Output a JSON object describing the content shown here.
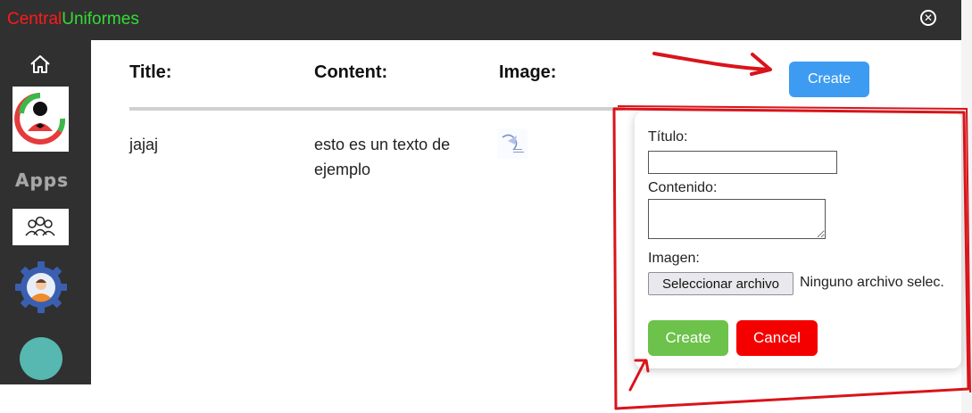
{
  "app": {
    "brand_part1": "Central",
    "brand_part2": "Uniformes",
    "close_icon": "close-circle-icon"
  },
  "sidebar": {
    "items": [
      {
        "icon": "home-icon"
      },
      {
        "icon": "logo-icon"
      },
      {
        "label": "Apps"
      },
      {
        "icon": "users-icon"
      },
      {
        "icon": "profile-settings-icon"
      },
      {
        "icon": "circle-icon"
      }
    ]
  },
  "table": {
    "headers": [
      "Title:",
      "Content:",
      "Image:"
    ],
    "rows": [
      {
        "title": "jajaj",
        "content": "esto es un texto de ejemplo",
        "image_icon": "thumbnail-image"
      }
    ]
  },
  "toolbar": {
    "create_label": "Create"
  },
  "modal": {
    "title_label": "Título:",
    "title_value": "",
    "content_label": "Contenido:",
    "content_value": "",
    "image_label": "Imagen:",
    "file_button_label": "Seleccionar archivo",
    "file_status": "Ninguno archivo selec.",
    "create_label": "Create",
    "cancel_label": "Cancel"
  },
  "colors": {
    "topbar": "#303030",
    "brand_red": "#ff1a1a",
    "brand_green": "#33dd33",
    "create_blue": "#3d9cf2",
    "create_green": "#6cc24a",
    "cancel_red": "#f40000",
    "annotation_red": "#d9141a"
  }
}
